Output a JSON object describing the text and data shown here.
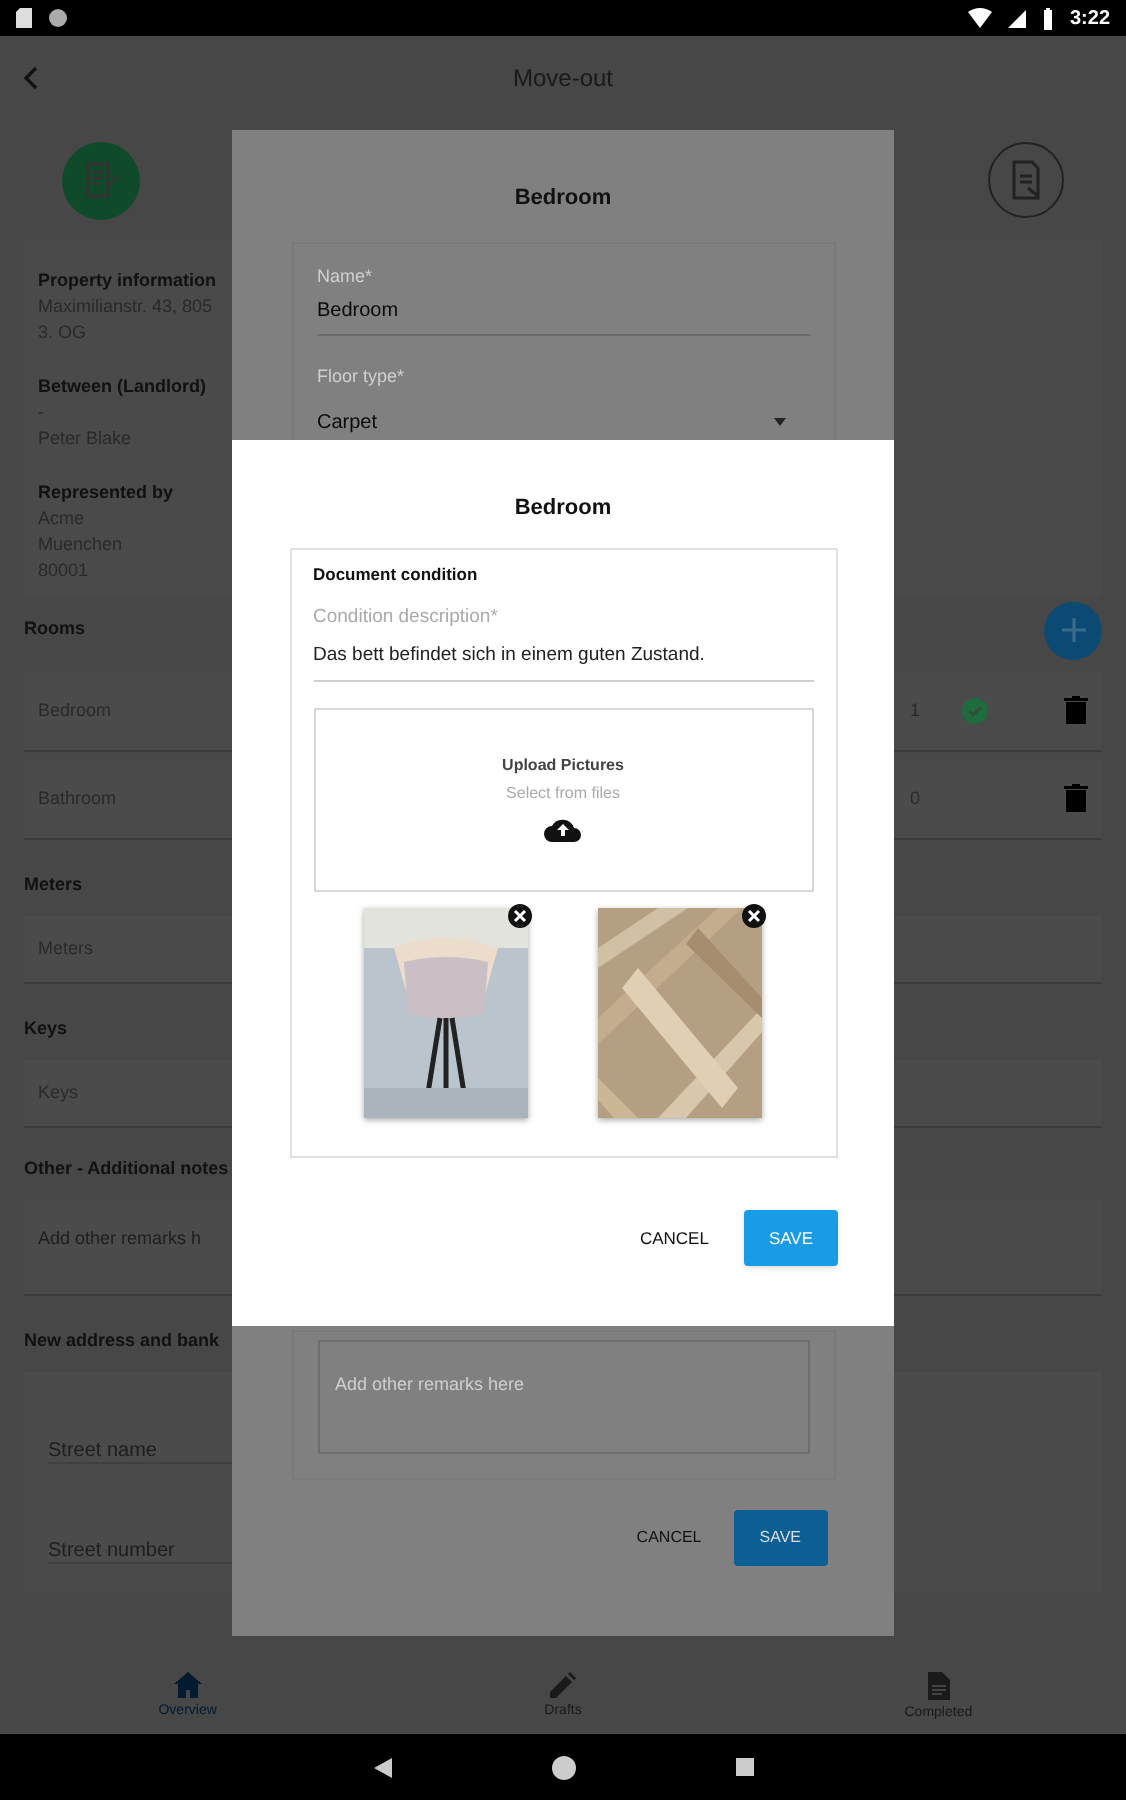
{
  "status_bar": {
    "time": "3:22"
  },
  "app_bar": {
    "title": "Move-out"
  },
  "info_sections": [
    {
      "label": "Property information",
      "lines": [
        "Maximilianstr. 43, 805",
        "3. OG"
      ]
    },
    {
      "label": "Between (Landlord)",
      "lines": [
        "-",
        "Peter Blake"
      ]
    },
    {
      "label": "Represented by",
      "lines": [
        "Acme",
        "Muenchen",
        "80001"
      ]
    }
  ],
  "rooms": {
    "label": "Rooms",
    "items": [
      {
        "name": "Bedroom",
        "count": "1",
        "completed": true
      },
      {
        "name": "Bathroom",
        "count": "0",
        "completed": false
      }
    ]
  },
  "meters": {
    "label": "Meters",
    "row": "Meters"
  },
  "keys": {
    "label": "Keys",
    "row": "Keys"
  },
  "other_notes": {
    "label": "Other - Additional notes",
    "placeholder": "Add other remarks h"
  },
  "new_address": {
    "label": "New address and bank",
    "fields": [
      {
        "placeholder": "Street name"
      },
      {
        "placeholder": "Street number"
      }
    ]
  },
  "bottom_nav": [
    {
      "label": "Overview",
      "selected": true,
      "kind": "home"
    },
    {
      "label": "Drafts",
      "selected": false,
      "kind": "pencil"
    },
    {
      "label": "Completed",
      "selected": false,
      "kind": "document"
    }
  ],
  "room_dialog": {
    "title": "Bedroom",
    "name_field": {
      "label": "Name*",
      "value": "Bedroom"
    },
    "floor_field": {
      "label": "Floor type*",
      "value": "Carpet"
    },
    "remarks": {
      "placeholder": "Add other remarks here"
    },
    "cancel": "CANCEL",
    "save": "SAVE"
  },
  "condition_dialog": {
    "title": "Bedroom",
    "section_title": "Document condition",
    "description": {
      "label": "Condition description*",
      "value": "Das bett befindet sich in einem guten Zustand."
    },
    "upload": {
      "title": "Upload Pictures",
      "subtitle": "Select from files"
    },
    "photos": [
      {
        "kind": "lamp"
      },
      {
        "kind": "parquet"
      }
    ],
    "cancel": "CANCEL",
    "save": "SAVE"
  }
}
